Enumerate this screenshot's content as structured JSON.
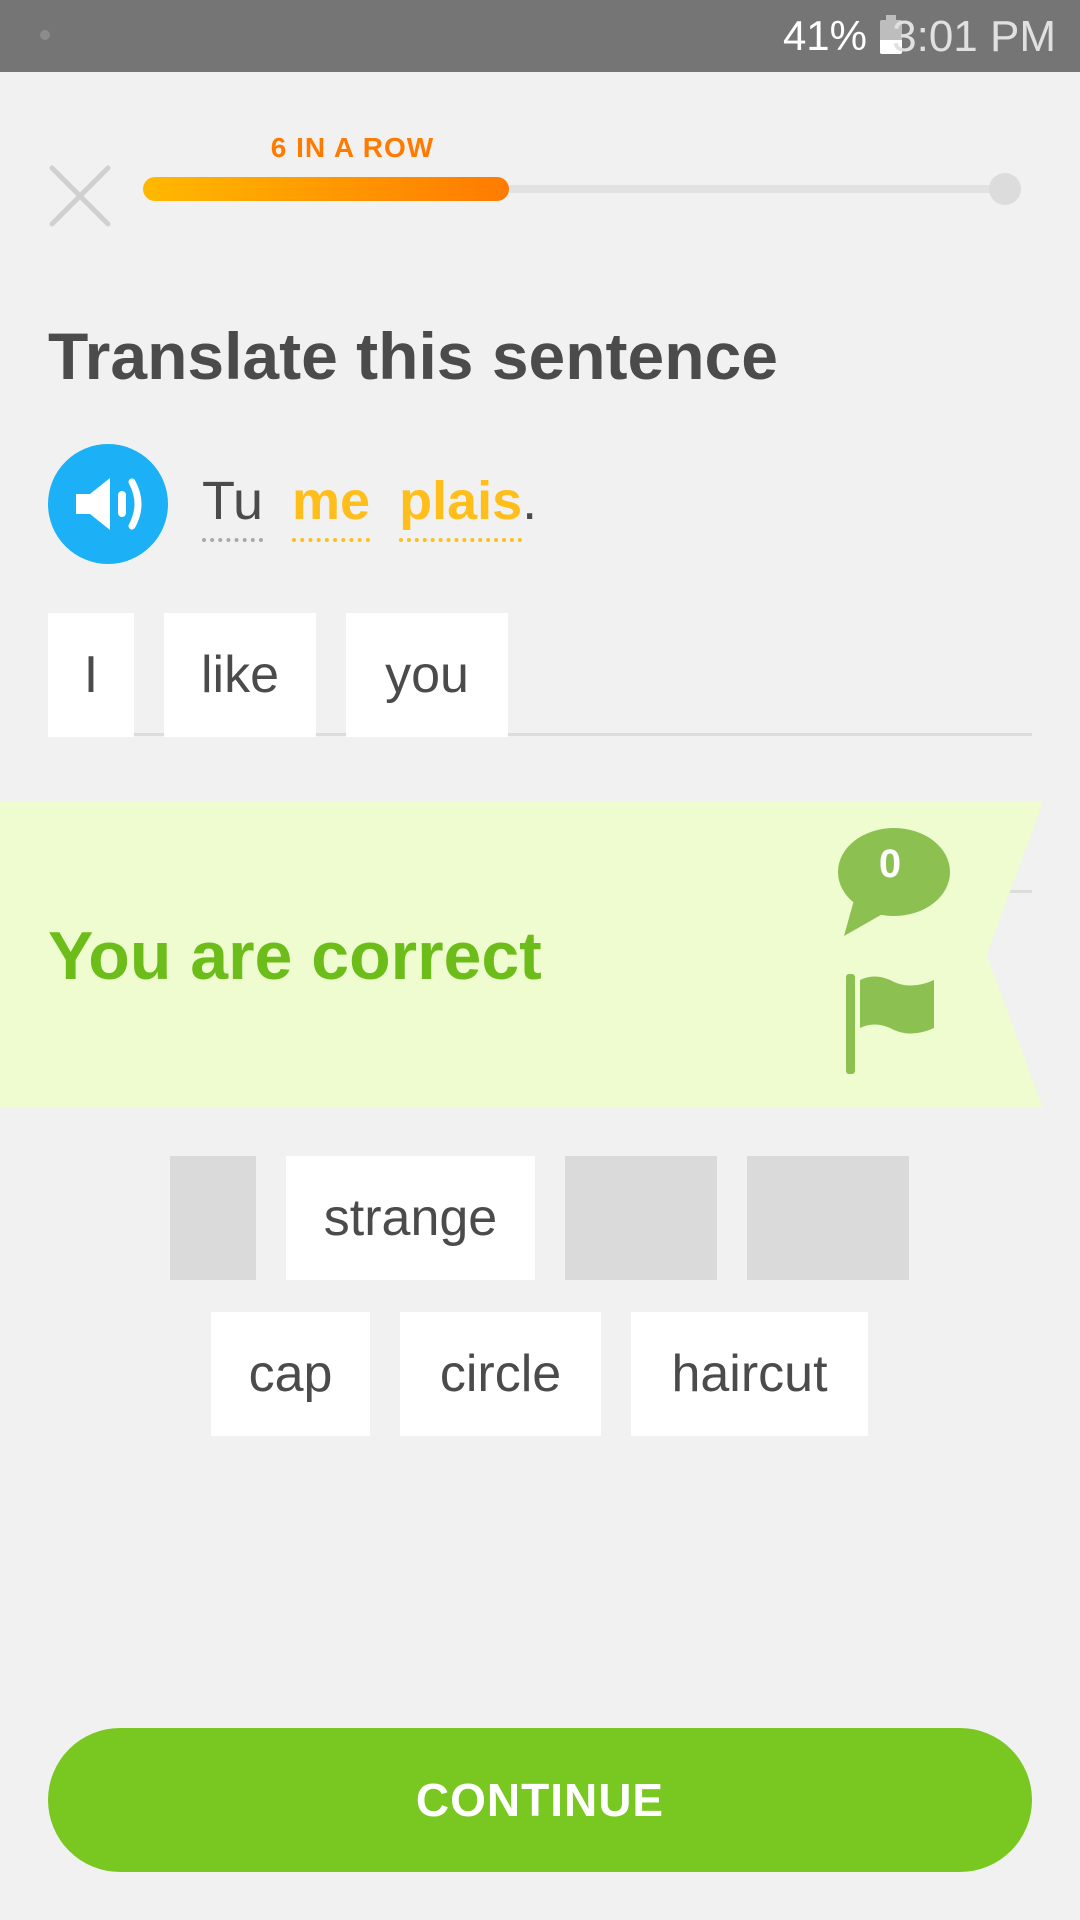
{
  "status_bar": {
    "battery": "41%",
    "time": "3:01 PM"
  },
  "header": {
    "streak_label": "6 IN A ROW",
    "progress": 0.42
  },
  "lesson": {
    "title": "Translate this sentence",
    "prompt_words": [
      "Tu",
      "me",
      "plais"
    ],
    "prompt_period": "."
  },
  "answer_tiles": [
    "I",
    "like",
    "you"
  ],
  "word_bank": {
    "row1": [
      "",
      "strange",
      "",
      ""
    ],
    "row2": [
      "cap",
      "circle",
      "haircut"
    ]
  },
  "feedback": {
    "message": "You are correct",
    "comment_count": "0"
  },
  "continue_label": "CONTINUE",
  "colors": {
    "accent_green": "#78c821",
    "correct_text": "#6cbd1a",
    "banner_bg": "#eefccf",
    "new_word": "#ffbe1a",
    "speaker_blue": "#1cb0f6",
    "streak_orange": "#ff7b00"
  },
  "icons": [
    "close-icon",
    "speaker-icon",
    "comment-icon",
    "flag-icon",
    "battery-icon"
  ]
}
